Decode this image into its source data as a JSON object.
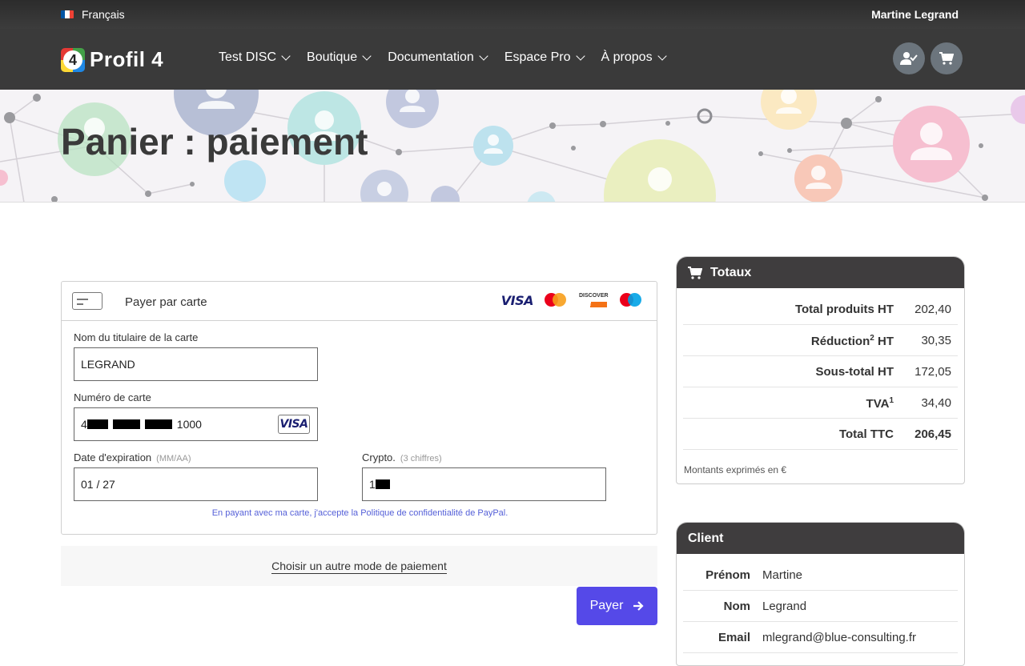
{
  "topbar": {
    "language": "Français",
    "user_name": "Martine Legrand"
  },
  "nav": {
    "logo_digit": "4",
    "logo_text": "Profil 4",
    "menu": [
      {
        "label": "Test DISC"
      },
      {
        "label": "Boutique"
      },
      {
        "label": "Documentation"
      },
      {
        "label": "Espace Pro"
      },
      {
        "label": "À propos"
      }
    ],
    "icons": [
      "user-check-icon",
      "cart-icon"
    ]
  },
  "page": {
    "title": "Panier : paiement"
  },
  "payment": {
    "method_title": "Payer par carte",
    "brands": [
      "VISA",
      "mastercard",
      "DISCOVER",
      "maestro"
    ],
    "holder_label": "Nom du titulaire de la carte",
    "holder_value": "LEGRAND",
    "number_label": "Numéro de carte",
    "number_first": "4",
    "number_last": "1000",
    "number_brand": "VISA",
    "expiry_label": "Date d'expiration",
    "expiry_hint": "(MM/AA)",
    "expiry_value": "01 / 27",
    "cvv_label": "Crypto.",
    "cvv_hint": "(3 chiffres)",
    "cvv_first": "1",
    "consent": "En payant avec ma carte, j'accepte la Politique de confidentialité de PayPal.",
    "alt_method": "Choisir un autre mode de paiement",
    "pay_button": "Payer"
  },
  "totals": {
    "title": "Totaux",
    "rows": [
      {
        "label": "Total produits HT",
        "sup": "",
        "value": "202,40"
      },
      {
        "label": "Réduction",
        "sup": "2",
        "suffix": " HT",
        "value": "30,35"
      },
      {
        "label": "Sous-total HT",
        "sup": "",
        "value": "172,05"
      },
      {
        "label": "TVA",
        "sup": "1",
        "value": "34,40"
      },
      {
        "label": "Total TTC",
        "sup": "",
        "value": "206,45"
      }
    ],
    "note": "Montants exprimés en €"
  },
  "client": {
    "title": "Client",
    "rows": [
      {
        "label": "Prénom",
        "value": "Martine"
      },
      {
        "label": "Nom",
        "value": "Legrand"
      },
      {
        "label": "Email",
        "value": "mlegrand@blue-consulting.fr"
      }
    ]
  },
  "colors": {
    "pay_button": "#5549e8",
    "nav_bg": "#3a3a3a",
    "panel_head": "#3f3d3e",
    "consent_link": "#5560d8"
  }
}
